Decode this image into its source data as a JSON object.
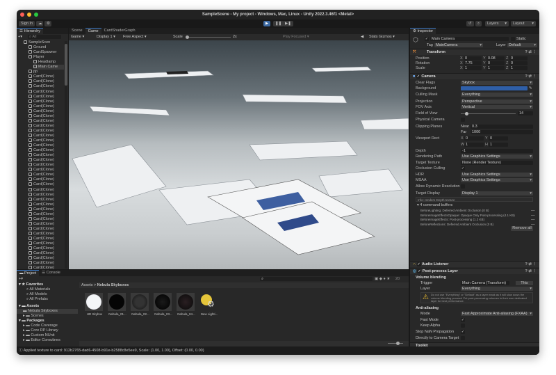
{
  "window": {
    "title": "SampleScene - My project - Windows, Mac, Linux - Unity 2022.3.46f1 <Metal>"
  },
  "toolbar": {
    "sign_in": "Sign In",
    "cloud_icon": "cloud-icon",
    "collab_icon": "collab-icon",
    "play": "▶",
    "pause": "❚❚",
    "step": "▶❚",
    "history_icon": "↺",
    "search_icon": "⌕",
    "layers": "Layers",
    "layout": "Layout"
  },
  "hierarchy": {
    "tab": "Hierarchy",
    "search_placeholder": "All",
    "add": "+▾",
    "items": [
      {
        "label": "SampleScen",
        "depth": 0
      },
      {
        "label": "Ground",
        "depth": 1
      },
      {
        "label": "CardSpawner",
        "depth": 1
      },
      {
        "label": "Player",
        "depth": 1
      },
      {
        "label": "Headlamp",
        "depth": 2
      },
      {
        "label": "Main Came",
        "depth": 2
      },
      {
        "label": "pp",
        "depth": 1
      }
    ],
    "clone_label": "Card(Clone)",
    "clone_count": 40
  },
  "game": {
    "tabs": [
      "Scene",
      "Game",
      "CardShaderGraph"
    ],
    "active_tab": 1,
    "mode": "Game",
    "display": "Display 1",
    "aspect": "Free Aspect",
    "scale_label": "Scale",
    "scale_value": "2x",
    "play_focused": "Play Focused",
    "stats": "Stats",
    "gizmos": "Gizmos"
  },
  "inspector": {
    "tab": "Inspector",
    "name": "Main Camera",
    "static": "Static",
    "tag_label": "Tag",
    "tag": "MainCamera",
    "layer_label": "Layer",
    "layer": "Default",
    "transform": {
      "title": "Transform",
      "position_label": "Position",
      "position": [
        "0",
        "0.08",
        "0"
      ],
      "rotation_label": "Rotation",
      "rotation": [
        "7.75",
        "0",
        "0"
      ],
      "scale_label": "Scale",
      "scale": [
        "1",
        "1",
        "1"
      ]
    },
    "camera": {
      "title": "Camera",
      "fields": [
        {
          "label": "Clear Flags",
          "value": "Skybox",
          "type": "dd"
        },
        {
          "label": "Background",
          "value": "",
          "type": "color"
        },
        {
          "label": "Culling Mask",
          "value": "Everything",
          "type": "dd"
        },
        {
          "label": "Projection",
          "value": "Perspective",
          "type": "dd"
        },
        {
          "label": "FOV Axis",
          "value": "Vertical",
          "type": "dd"
        },
        {
          "label": "Field of View",
          "value": "14",
          "type": "slider"
        },
        {
          "label": "Physical Camera",
          "value": "",
          "type": "check"
        }
      ],
      "clipping_label": "Clipping Planes",
      "near_label": "Near",
      "near": "0.3",
      "far_label": "Far",
      "far": "1000",
      "viewport_label": "Viewport Rect",
      "viewport": {
        "x": "0",
        "y": "0",
        "w": "1",
        "h": "1"
      },
      "fields2": [
        {
          "label": "Depth",
          "value": "-1",
          "type": "text"
        },
        {
          "label": "Rendering Path",
          "value": "Use Graphics Settings",
          "type": "dd"
        },
        {
          "label": "Target Texture",
          "value": "None (Render Texture)",
          "type": "obj"
        },
        {
          "label": "Occlusion Culling",
          "value": "✓",
          "type": "check"
        },
        {
          "label": "HDR",
          "value": "Use Graphics Settings",
          "type": "dd"
        },
        {
          "label": "MSAA",
          "value": "Use Graphics Settings",
          "type": "dd"
        },
        {
          "label": "Allow Dynamic Resolution",
          "value": "",
          "type": "check"
        },
        {
          "label": "Target Display",
          "value": "Display 1",
          "type": "dd"
        }
      ],
      "info": "Info: renders Depth texture",
      "buffers_title": "4 command buffers",
      "buffers": [
        "BeforeLighting: Deferred Ambient Occlusion (0 B)",
        "BeforeImageEffectsOpaque: Opaque Only Post-processing (4.1 KB)",
        "BeforeImageEffects: Post-processing (1.2 KB)",
        "BeforeReflections: Deferred Ambient Occlusion (0 B)"
      ],
      "remove_all": "Remove all"
    },
    "audio": {
      "title": "Audio Listener"
    },
    "post": {
      "title": "Post-process Layer",
      "volume_blending": "Volume blending",
      "trigger_label": "Trigger",
      "trigger": "Main Camera (Transform)",
      "this": "This",
      "layer_label": "Layer",
      "layer": "Everything",
      "warning": "Do not use \"Everything\" or \"Default\" as a layer mask as it will slow down the volume blending process! Put post-processing volumes in their own dedicated layer for best performance.",
      "aa": "Anti-aliasing",
      "mode_label": "Mode",
      "mode": "Fast Approximate Anti-aliasing (FXAA)",
      "fast_mode": "Fast Mode",
      "keep_alpha": "Keep Alpha",
      "stop_nan": "Stop NaN Propagation",
      "direct": "Directly to Camera Target",
      "toolkit": "Toolkit"
    }
  },
  "project": {
    "tabs": [
      "Project",
      "Console"
    ],
    "add": "+▾",
    "favorites": "Favorites",
    "fav_items": [
      "All Materials",
      "All Models",
      "All Prefabs"
    ],
    "assets": "Assets",
    "asset_items": [
      "Nebula Skyboxes",
      "Scenes"
    ],
    "packages": "Packages",
    "package_items": [
      "Code Coverage",
      "Core RP Library",
      "Custom NUnit",
      "Editor Coroutines"
    ],
    "breadcrumb": [
      "Assets",
      "Nebula Skyboxes"
    ],
    "hidden_count": "20",
    "files": [
      "HD Skybox",
      "Nebula_01...",
      "Nebula_02...",
      "Nebula_03...",
      "Nebula_04...",
      "New Lighti..."
    ]
  },
  "status": {
    "message": "Applied texture to card: 912b2765-dad6-4508-b91e-b2588c8e5ee9, Scale: (1.00, 1.00), Offset: (0.00, 0.00)"
  }
}
